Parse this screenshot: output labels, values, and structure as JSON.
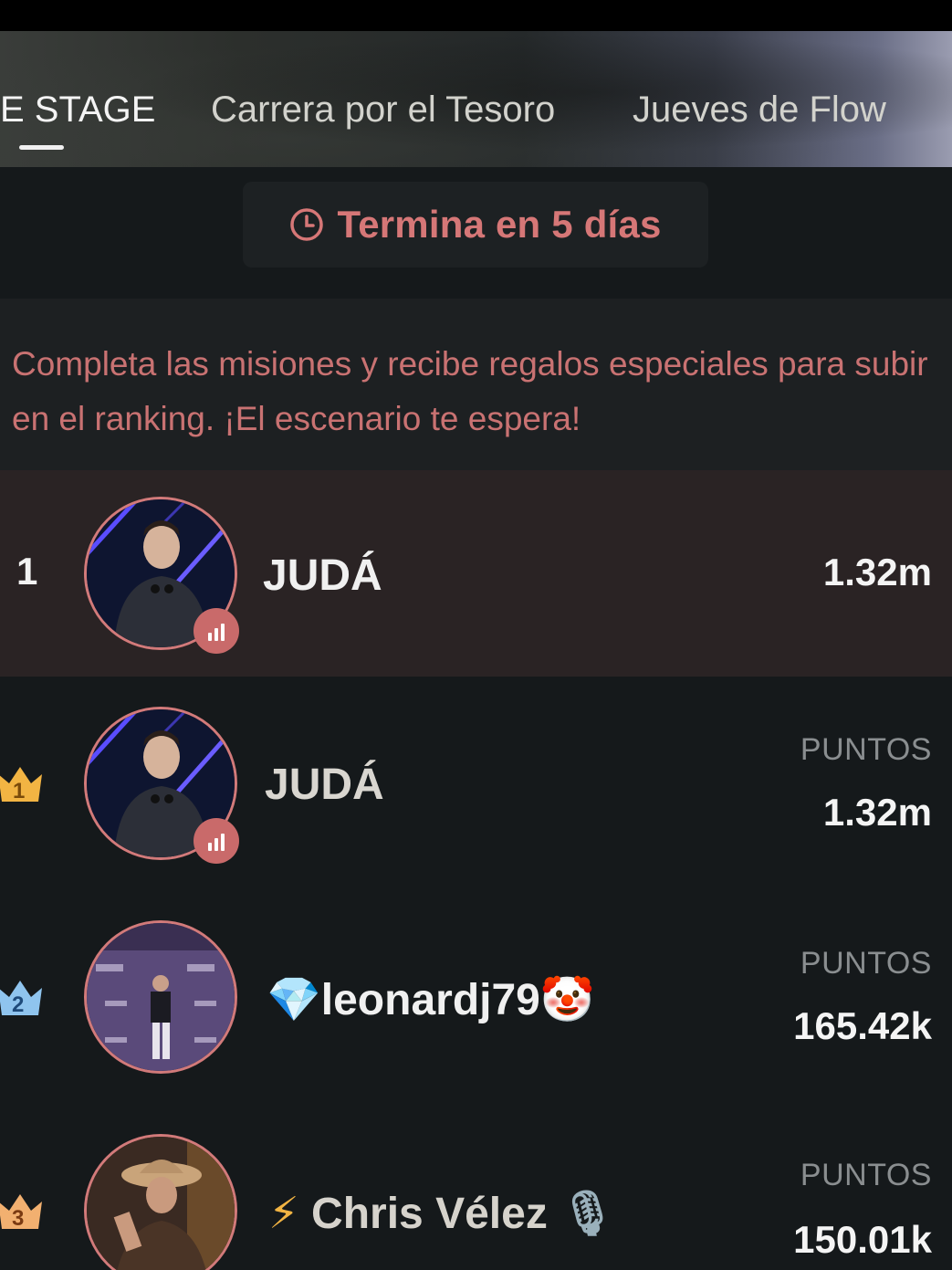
{
  "tabs": [
    {
      "label": "E STAGE",
      "active": true
    },
    {
      "label": "Carrera por el Tesoro",
      "active": false
    },
    {
      "label": "Jueves de Flow",
      "active": false
    }
  ],
  "timer": {
    "icon": "clock-icon",
    "text": "Termina en 5 días"
  },
  "info": {
    "text": "Completa las misiones y recibe regalos especiales para subir en el ranking. ¡El escenario te espera!"
  },
  "my_rank": {
    "rank": "1",
    "name": "JUDÁ",
    "points": "1.32m"
  },
  "leaderboard": [
    {
      "rank": "1",
      "name": "JUDÁ",
      "points_label": "PUNTOS",
      "points": "1.32m",
      "crown_color": "#f2b443"
    },
    {
      "rank": "2",
      "name_prefix": "💎",
      "name": "leonardj79",
      "name_suffix": "🤡",
      "points_label": "PUNTOS",
      "points": "165.42k",
      "crown_color": "#8fc4ee"
    },
    {
      "rank": "3",
      "name_prefix": "⚡",
      "name": "Chris Vélez",
      "name_suffix": "🎙",
      "points_label": "PUNTOS",
      "points": "150.01k",
      "crown_color": "#f2b070"
    }
  ],
  "colors": {
    "accent": "#d67777",
    "background": "#15191b",
    "highlight_row": "#2a2324"
  }
}
